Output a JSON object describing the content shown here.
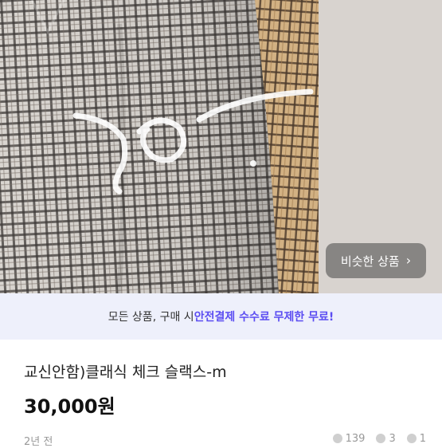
{
  "photo": {
    "handwriting": "10.",
    "similar_button": {
      "label": "비슷한 상품",
      "chevron": "chevron-right-icon"
    }
  },
  "promo": {
    "prefix": "모든 상품, 구매 시 ",
    "highlight": "안전결제 수수료 무제한 무료!",
    "accent_color": "#5b4df2"
  },
  "product": {
    "title": "교신안함)클래식 체크 슬랙스-m",
    "price": "30,000원"
  },
  "meta": {
    "time": "2년 전",
    "views": "139",
    "likes": "3",
    "chats": "1"
  }
}
